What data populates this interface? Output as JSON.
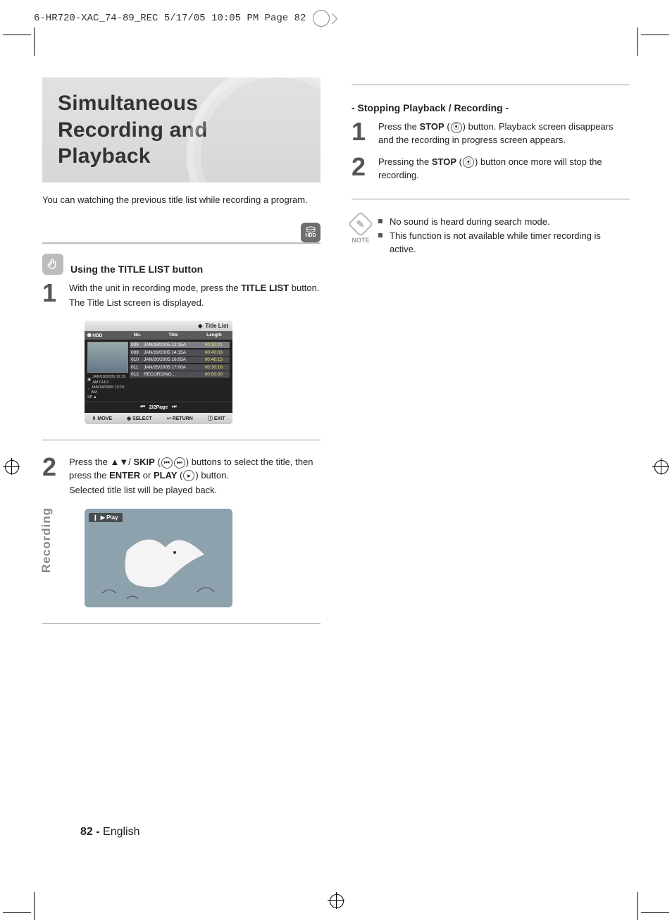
{
  "prepress": {
    "slug": "6-HR720-XAC_74-89_REC  5/17/05  10:05 PM  Page 82"
  },
  "title": "Simultaneous Recording and Playback",
  "intro": "You can watching the previous title list while recording a program.",
  "hdd_badge": "HDD",
  "section_head": "Using the TITLE LIST button",
  "left_steps": {
    "one": {
      "num": "1",
      "line1_a": "With the unit in recording mode, press the ",
      "line1_b_bold": "TITLE LIST",
      "line1_c": " button.",
      "line2": "The Title List screen is displayed."
    },
    "two": {
      "num": "2",
      "line1_a": "Press the ▲▼/ ",
      "line1_b_bold": "SKIP",
      "line1_c": " (",
      "line1_d": ") buttons to select the title, then press the ",
      "line1_e_bold": "ENTER",
      "line1_f": " or ",
      "line1_g_bold": "PLAY",
      "line1_h": " (",
      "line1_i": ") button.",
      "line2": "Selected title list will be played back."
    }
  },
  "title_list_ui": {
    "top_label": "Title List",
    "header": {
      "device": "HDD",
      "no": "No.",
      "title": "Title",
      "length": "Length"
    },
    "thumb_meta": {
      "l1": "JAN/18/2005 12:15 AM CH11",
      "l2": "JAN/18/2005 12:15 AM",
      "l3": "SP"
    },
    "rows": [
      {
        "no": "008",
        "title": "JAN/18/2005 12:15A",
        "len": "00:10:21",
        "selected": true
      },
      {
        "no": "009",
        "title": "JAN/19/2005 14:15A",
        "len": "00:40:03"
      },
      {
        "no": "010",
        "title": "JAN/20/2005 16:05A",
        "len": "00:40:15"
      },
      {
        "no": "011",
        "title": "JAN/25/2005 17:00A",
        "len": "00:30:16"
      },
      {
        "no": "012",
        "title": "RECORDING...",
        "len": "00:00:00"
      }
    ],
    "paging": "2/2Page",
    "footer": {
      "move": "MOVE",
      "select": "SELECT",
      "return": "RETURN",
      "exit": "EXIT"
    }
  },
  "playback_ui": {
    "overlay": "▶ Play"
  },
  "right_heading": "- Stopping Playback / Recording -",
  "right_steps": {
    "one": {
      "num": "1",
      "a": "Press the ",
      "b_bold": "STOP",
      "c": " (",
      "d": ") button. Playback screen disappears and the recording in progress screen appears."
    },
    "two": {
      "num": "2",
      "a": "Pressing the ",
      "b_bold": "STOP",
      "c": " (",
      "d": ") button once more will stop the recording."
    }
  },
  "note": {
    "label": "NOTE",
    "items": [
      "No sound is heard during search mode.",
      "This function is not available while timer recording is active."
    ]
  },
  "side_tab": "Recording",
  "footer": {
    "page": "82 -",
    "lang": "English"
  }
}
